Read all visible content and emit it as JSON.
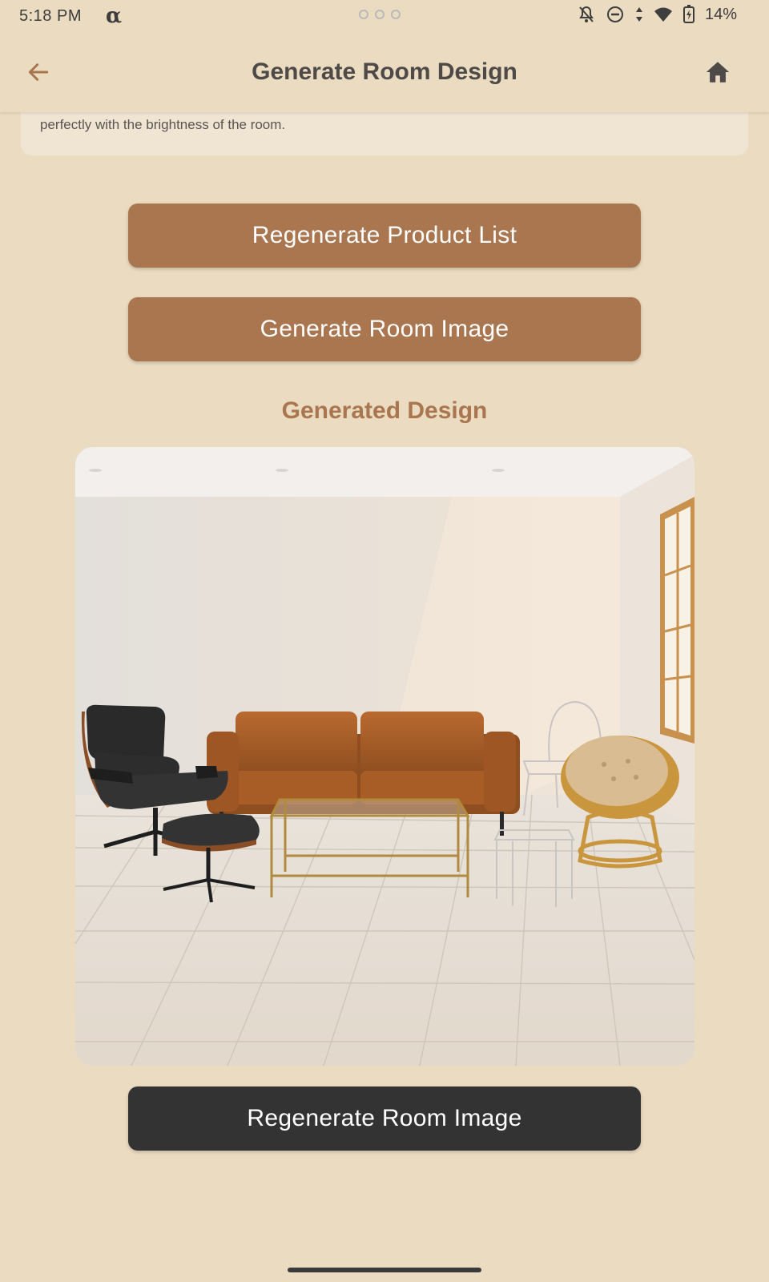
{
  "status_bar": {
    "time": "5:18 PM",
    "logo": "α",
    "battery": "14%",
    "icons": [
      "notifications-off-icon",
      "do-not-disturb-icon",
      "data-arrows-icon",
      "wifi-icon",
      "battery-charging-icon"
    ]
  },
  "app_bar": {
    "title": "Generate Room Design",
    "back_icon": "arrow-left-icon",
    "home_icon": "home-icon"
  },
  "description": {
    "text": "perfectly with the brightness of the room."
  },
  "buttons": {
    "regenerate_product_list": "Regenerate Product List",
    "generate_room_image": "Generate Room Image",
    "regenerate_room_image": "Regenerate Room Image"
  },
  "generated_design": {
    "title": "Generated Design"
  },
  "colors": {
    "background": "#eadbc1",
    "accent": "#a97650",
    "dark_button": "#333333"
  }
}
